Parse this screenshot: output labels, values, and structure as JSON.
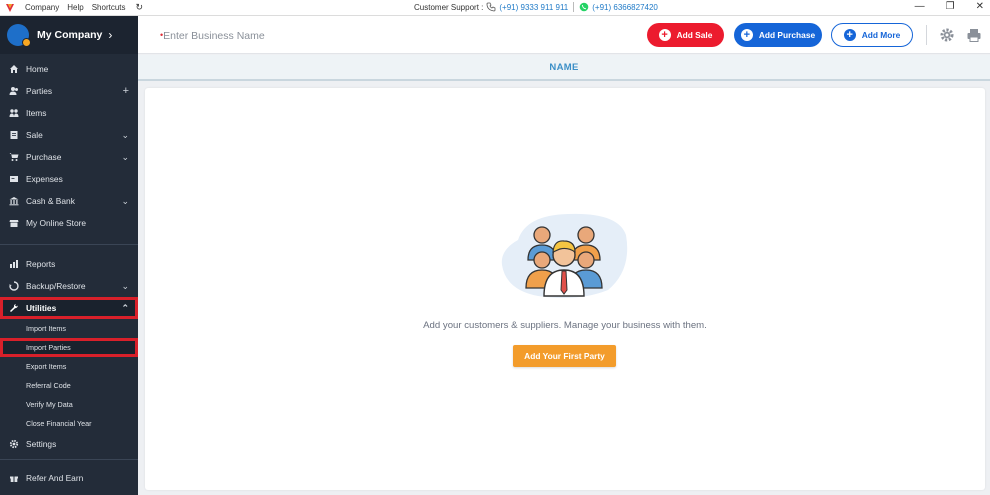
{
  "titlebar": {
    "menu": [
      "Company",
      "Help",
      "Shortcuts"
    ],
    "support_label": "Customer Support :",
    "phone_number": "(+91) 9333 911 911",
    "whatsapp_number": "(+91) 6366827420"
  },
  "sidebar": {
    "company_name": "My Company",
    "items": [
      {
        "label": "Home",
        "icon": "home-icon"
      },
      {
        "label": "Parties",
        "icon": "parties-icon",
        "right": "+"
      },
      {
        "label": "Items",
        "icon": "items-icon"
      },
      {
        "label": "Sale",
        "icon": "sale-icon",
        "right": "⌄"
      },
      {
        "label": "Purchase",
        "icon": "cart-icon",
        "right": "⌄"
      },
      {
        "label": "Expenses",
        "icon": "expenses-icon"
      },
      {
        "label": "Cash & Bank",
        "icon": "bank-icon",
        "right": "⌄"
      },
      {
        "label": "My Online Store",
        "icon": "store-icon"
      }
    ],
    "items2": [
      {
        "label": "Reports",
        "icon": "reports-icon"
      },
      {
        "label": "Backup/Restore",
        "icon": "backup-icon",
        "right": "⌄"
      },
      {
        "label": "Utilities",
        "icon": "wrench-icon",
        "right": "⌃"
      }
    ],
    "utilities_sub": [
      "Import Items",
      "Import Parties",
      "Export Items",
      "Referral Code",
      "Verify My Data",
      "Close Financial Year"
    ],
    "settings_label": "Settings",
    "refer_label": "Refer And Earn"
  },
  "header": {
    "business_placeholder": "Enter Business Name",
    "add_sale": "Add Sale",
    "add_purchase": "Add Purchase",
    "add_more": "Add More"
  },
  "table": {
    "column_header": "NAME"
  },
  "empty_state": {
    "message": "Add your customers & suppliers. Manage your business with them.",
    "cta": "Add Your First Party"
  },
  "colors": {
    "sidebar_bg": "#232c39",
    "sale": "#ec1b2e",
    "purchase": "#1565d8",
    "cta": "#f39c2b",
    "highlight": "#d8202a"
  }
}
